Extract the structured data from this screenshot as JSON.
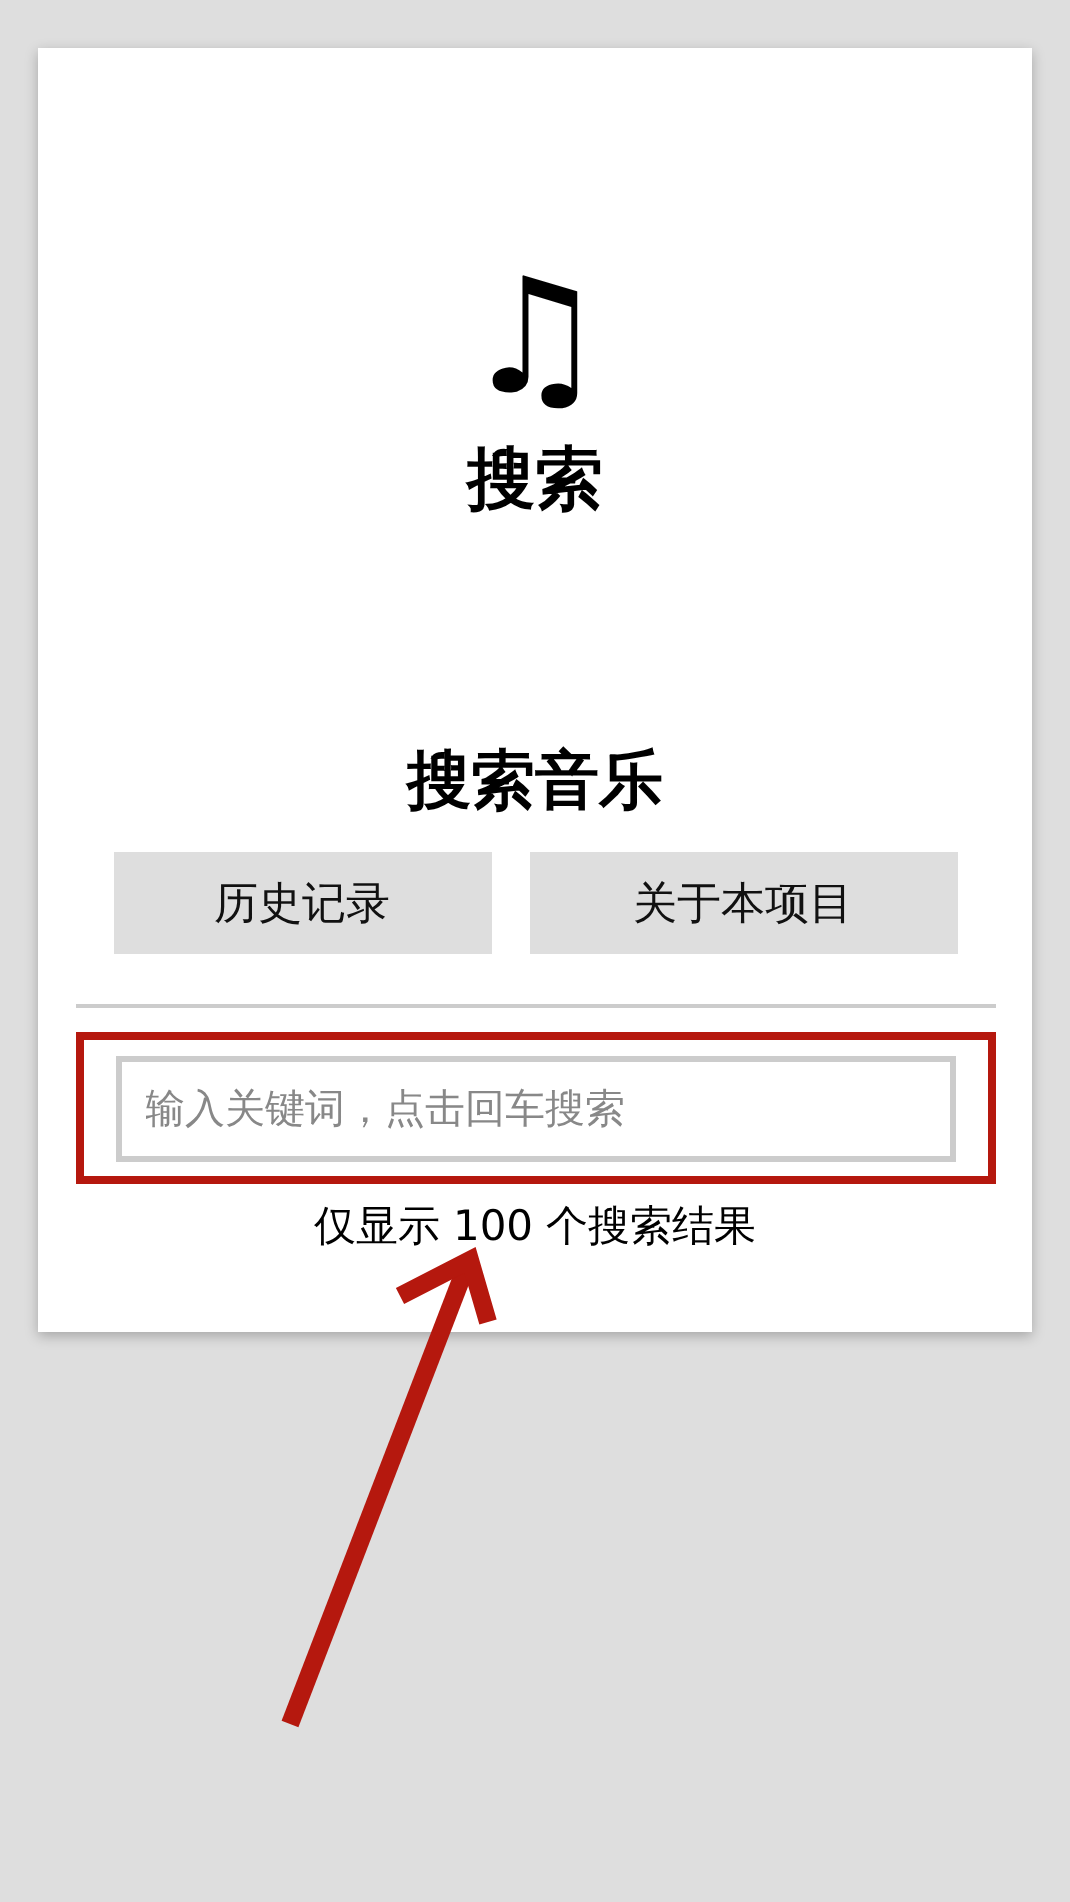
{
  "header": {
    "icon": "♫",
    "title": "搜索"
  },
  "section": {
    "title": "搜索音乐"
  },
  "buttons": [
    {
      "label": "历史记录"
    },
    {
      "label": "关于本项目"
    }
  ],
  "search": {
    "placeholder": "输入关键词，点击回车搜索"
  },
  "note": "仅显示 100 个搜索结果"
}
